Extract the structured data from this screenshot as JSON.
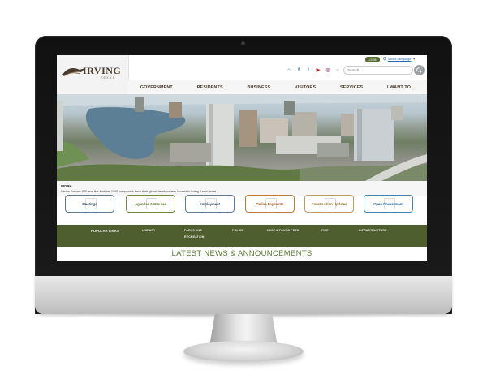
{
  "header": {
    "logo_word": "IRVING",
    "logo_sub": "TEXAS",
    "login_label": "LOGIN",
    "translate_icon_letter": "G",
    "translate_label": "Select Language",
    "translate_caret": "▼",
    "search_placeholder": "Search",
    "search_icon": "search-icon",
    "social_icons": [
      "home-icon",
      "facebook-icon",
      "twitter-icon",
      "youtube-icon",
      "instagram-icon",
      "nextdoor-icon"
    ]
  },
  "nav": {
    "items": [
      "GOVERNMENT",
      "RESIDENTS",
      "BUSINESS",
      "VISITORS",
      "SERVICES",
      "I WANT TO..."
    ]
  },
  "hero": {
    "caption_title": "WORK",
    "caption_text": "Seven Fortune 500 and five Fortune 1000 companies have their global headquarters located in Irving. Learn more ..."
  },
  "quick_links": [
    "Meetings",
    "Agendas & Minutes",
    "Employment",
    "Online Payments",
    "Construction Updates",
    "Open Government"
  ],
  "popular_links": {
    "heading": "POPULAR LINKS",
    "items": [
      "LIBRARY",
      "PARKS AND",
      "RECREATION",
      "POLICE",
      "LOST & FOUND PETS",
      "FIRE",
      "INFRASTRUCTURE"
    ]
  },
  "news_heading": "LATEST NEWS & ANNOUNCEMENTS",
  "colors": {
    "brand_green": "#556b2f",
    "nav_text": "#4a3826",
    "news_green": "#5a7a2e"
  }
}
